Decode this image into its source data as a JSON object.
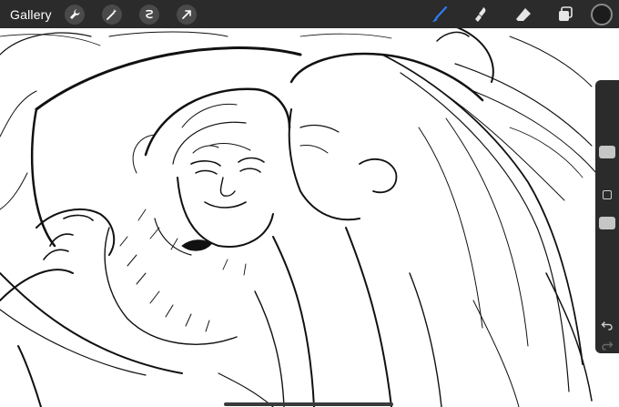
{
  "app": {
    "gallery_label": "Gallery"
  },
  "toolbar": {
    "left_tools": [
      "wrench-icon",
      "magic-wand-icon",
      "selection-icon",
      "transform-icon"
    ],
    "right_tools": [
      "brush-icon",
      "smudge-icon",
      "eraser-icon",
      "layers-icon"
    ],
    "active_tool": "brush-icon",
    "active_color": "#1c1c1c",
    "accent_color": "#2f7cf6"
  },
  "sidebar": {
    "brush_size_slider": "brush-size-slider",
    "opacity_slider": "opacity-slider",
    "modify_button": "modify-button",
    "undo": "undo-icon",
    "redo": "redo-icon"
  }
}
